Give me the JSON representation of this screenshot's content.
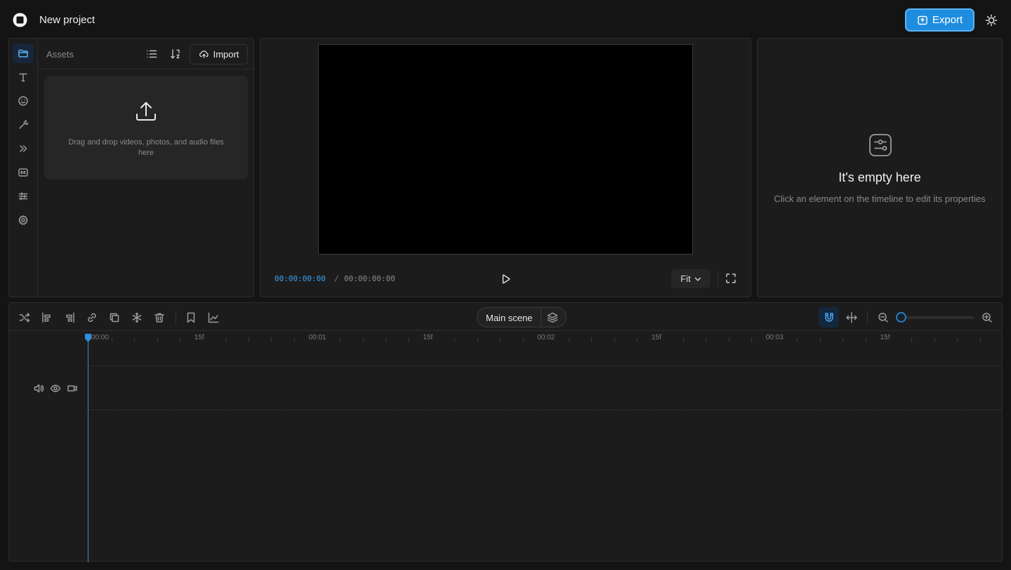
{
  "app": {
    "project_title": "New project",
    "export_label": "Export",
    "accent_color": "#1e8de0"
  },
  "sidebar": {
    "items": [
      {
        "name": "folder-icon",
        "active": true
      },
      {
        "name": "text-icon",
        "active": false
      },
      {
        "name": "sticker-icon",
        "active": false
      },
      {
        "name": "magic-wand-icon",
        "active": false
      },
      {
        "name": "transitions-icon",
        "active": false
      },
      {
        "name": "captions-icon",
        "active": false
      },
      {
        "name": "adjustments-icon",
        "active": false
      },
      {
        "name": "settings-icon",
        "active": false
      }
    ]
  },
  "assets": {
    "title": "Assets",
    "import_label": "Import",
    "dropzone_text": "Drag and drop videos, photos, and audio files here"
  },
  "preview": {
    "current_time": "00:00:00:00",
    "separator": "/",
    "total_time": "00:00:00:00",
    "fit_label": "Fit"
  },
  "properties": {
    "empty_title": "It's empty here",
    "empty_subtitle": "Click an element on the timeline to edit its properties"
  },
  "timeline": {
    "scene_label": "Main scene",
    "ruler_labels": [
      "00:00",
      "15f",
      "00:01",
      "15f",
      "00:02",
      "15f",
      "00:03",
      "15f"
    ],
    "zoom_level": 0,
    "playhead_time": "00:00"
  }
}
